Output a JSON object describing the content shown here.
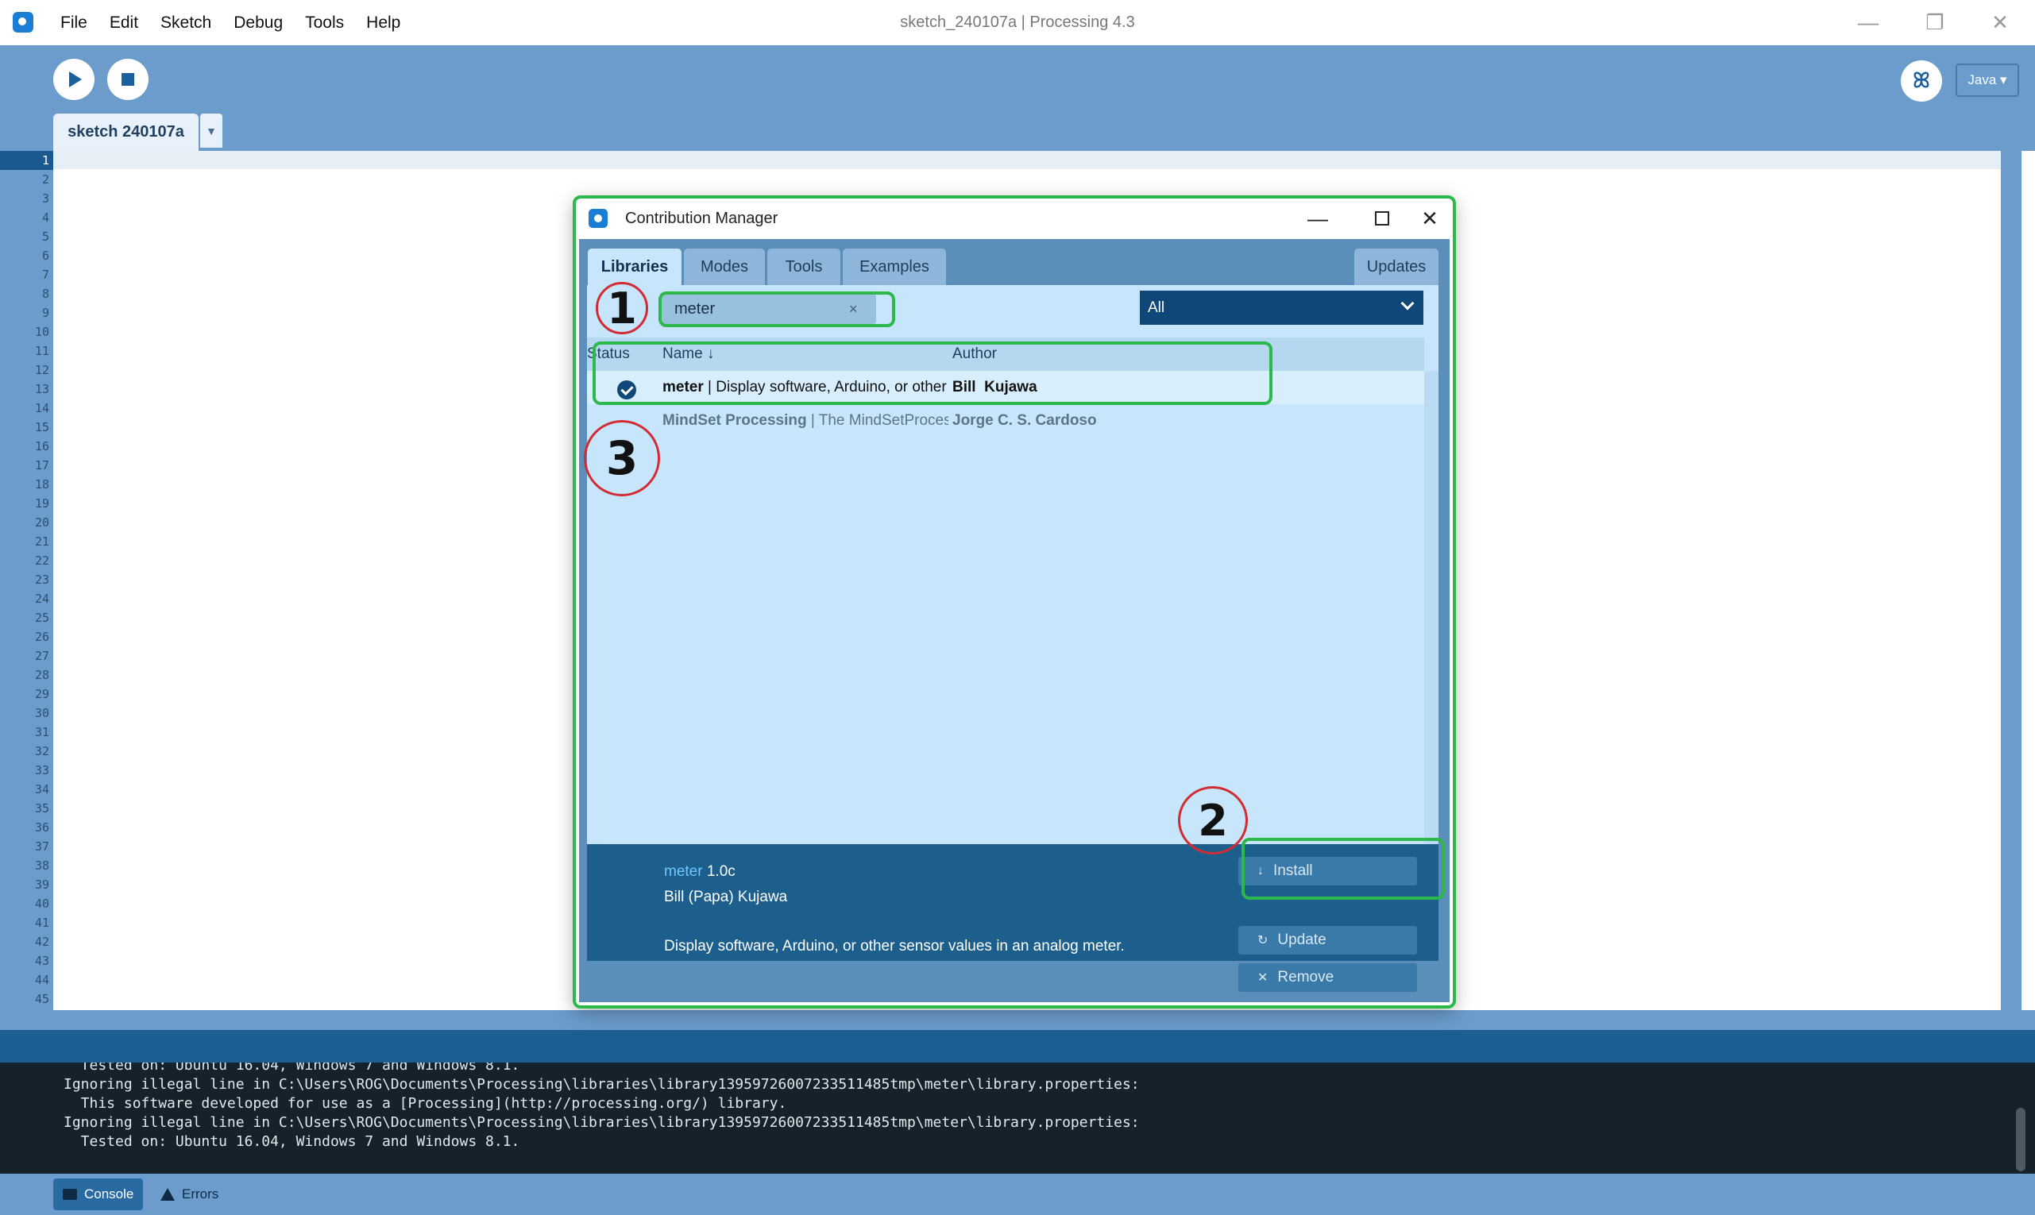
{
  "window": {
    "title": "sketch_240107a | Processing 4.3",
    "minimize": "—",
    "restore": "❐",
    "close": "✕"
  },
  "menu": [
    "File",
    "Edit",
    "Sketch",
    "Debug",
    "Tools",
    "Help"
  ],
  "toolbar": {
    "mode": "Java ▾",
    "debug_glyph": "ꕤ"
  },
  "sketch_tab": {
    "name": "sketch 240107a",
    "arrow": "▼"
  },
  "editor": {
    "line_numbers": [
      "1",
      "2",
      "3",
      "4",
      "5",
      "6",
      "7",
      "8",
      "9",
      "10",
      "11",
      "12",
      "13",
      "14",
      "15",
      "16",
      "17",
      "18",
      "19",
      "20",
      "21",
      "22",
      "23",
      "24",
      "25",
      "26",
      "27",
      "28",
      "29",
      "30",
      "31",
      "32",
      "33",
      "34",
      "35",
      "36",
      "37",
      "38",
      "39",
      "40",
      "41",
      "42",
      "43",
      "44",
      "45"
    ],
    "active_line": "1"
  },
  "console": {
    "lines": [
      "  Tested on: Ubuntu 16.04, Windows 7 and Windows 8.1.",
      "Ignoring illegal line in C:\\Users\\ROG\\Documents\\Processing\\libraries\\library13959726007233511485tmp\\meter\\library.properties:",
      "  This software developed for use as a [Processing](http://processing.org/) library.",
      "Ignoring illegal line in C:\\Users\\ROG\\Documents\\Processing\\libraries\\library13959726007233511485tmp\\meter\\library.properties:",
      "  Tested on: Ubuntu 16.04, Windows 7 and Windows 8.1."
    ],
    "tabs": {
      "console": "Console",
      "errors": "Errors"
    }
  },
  "dialog": {
    "title": "Contribution Manager",
    "tabs": [
      "Libraries",
      "Modes",
      "Tools",
      "Examples"
    ],
    "updates_tab": "Updates",
    "search_value": "meter",
    "search_clear": "×",
    "category": "All",
    "columns": {
      "status": "Status",
      "name": "Name ↓",
      "author": "Author"
    },
    "rows": [
      {
        "name": "meter",
        "desc": " | Display software, Arduino, or other sensor values in an ...",
        "author": "Bill  Kujawa",
        "installed": true
      },
      {
        "name": "MindSet Processing",
        "desc": " | The MindSetProcessing library allows you...",
        "author": "Jorge C. S. Cardoso",
        "installed": false
      }
    ],
    "detail": {
      "name": "meter",
      "version": "1.0c",
      "author": "Bill (Papa) Kujawa",
      "description": "Display software, Arduino, or other sensor values in an analog meter.",
      "install": "Install",
      "update": "Update",
      "remove": "Remove",
      "install_icon": "↓",
      "update_icon": "↻",
      "remove_icon": "✕"
    }
  },
  "annotations": [
    "1",
    "2",
    "3"
  ],
  "colors": {
    "annotation_green": "#2db84b",
    "annotation_red": "#d32b34",
    "processing_blue": "#6b9ccb"
  }
}
